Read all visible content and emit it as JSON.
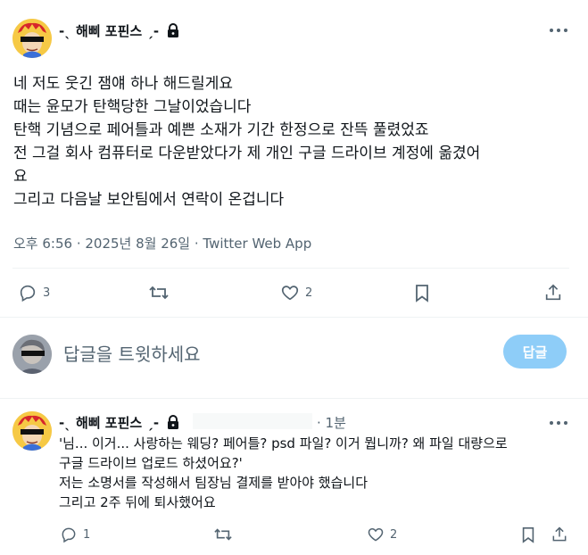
{
  "tweet": {
    "author": "-ˎ 해삐 포핀스 ˏ-",
    "lines": [
      "네 저도 웃긴 잼얘 하나 해드릴게요",
      "때는 윤모가 탄핵당한 그날이었습니다",
      "탄핵 기념으로 페어틀과 예쁜 소재가 기간 한정으로 잔뜩 풀렸었죠",
      "전 그걸 회사 컴퓨터로 다운받았다가 제 개인 구글 드라이브 계정에 옮겼어",
      "요",
      "그리고 다음날 보안팀에서 연락이 온겁니다"
    ],
    "meta": "오후 6:56 · 2025년 8월 26일 · Twitter Web App",
    "replies": "3",
    "likes": "2"
  },
  "compose": {
    "placeholder": "답글을 트윗하세요",
    "button": "답글"
  },
  "reply": {
    "author": "-ˎ 해삐 포핀스 ˏ-",
    "time": "· 1분",
    "lines": [
      "'님... 이거... 사랑하는 웨딩? 페어틀? psd 파일? 이거 뭡니까? 왜 파일 대량으로",
      "구글 드라이브 업로드 하셨어요?'",
      "저는 소명서를 작성해서 팀장님 결제를 받아야 했습니다",
      "그리고 2주 뒤에 퇴사했어요"
    ],
    "replies": "1",
    "likes": "2"
  },
  "colors": {
    "accent": "#1d9bf0",
    "reply_button": "#8ecdf8",
    "muted": "#536471"
  }
}
